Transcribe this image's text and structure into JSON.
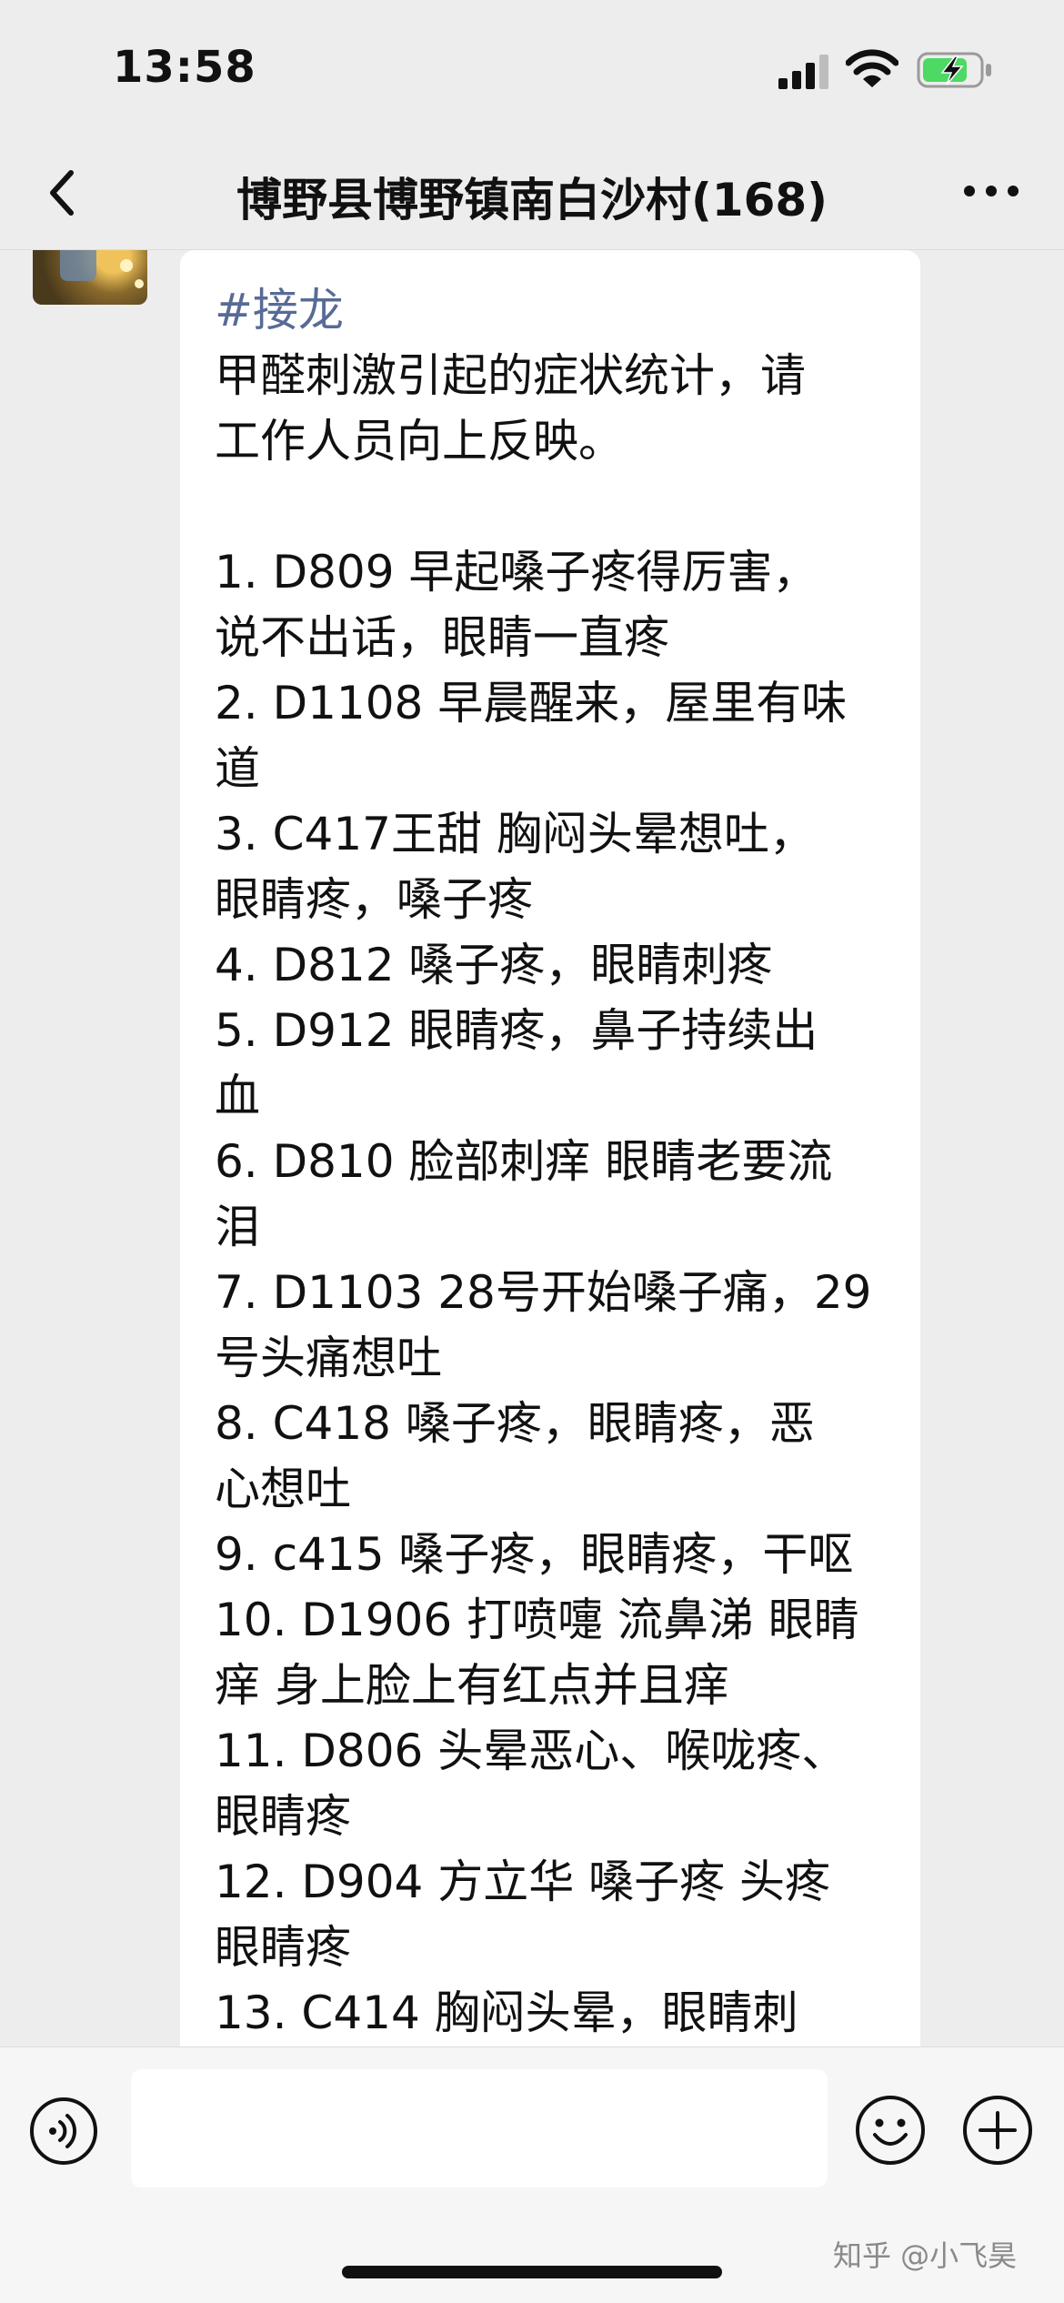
{
  "status_bar": {
    "time": "13:58"
  },
  "header": {
    "title": "博野县博野镇南白沙村(168)"
  },
  "message": {
    "hashtag": "#接龙",
    "lines": [
      "甲醛刺激引起的症状统计，请",
      "工作人员向上反映。",
      "",
      "1. D809 早起嗓子疼得厉害，",
      "说不出话，眼睛一直疼",
      "2. D1108 早晨醒来，屋里有味",
      "道",
      "3. C417王甜 胸闷头晕想吐，",
      "眼睛疼，嗓子疼",
      "4. D812 嗓子疼，眼睛刺疼",
      "5. D912 眼睛疼，鼻子持续出",
      "血",
      "6. D810 脸部刺痒 眼睛老要流",
      "泪",
      "7. D1103 28号开始嗓子痛，29",
      "号头痛想吐",
      "8. C418 嗓子疼，眼睛疼，恶",
      "心想吐",
      "9. c415 嗓子疼，眼睛疼，干呕",
      "10. D1906 打喷嚏 流鼻涕 眼睛",
      "痒 身上脸上有红点并且痒",
      "11. D806 头晕恶心、喉咙疼、",
      "眼睛疼",
      "12. D904 方立华 嗓子疼 头疼",
      "眼睛疼",
      "13. C414 胸闷头晕，眼睛刺"
    ]
  },
  "input": {
    "value": ""
  },
  "watermark": "知乎 @小飞昊",
  "colors": {
    "background": "#ededed",
    "bubble": "#ffffff",
    "hashtag": "#576b95",
    "battery_fill": "#4cd964"
  },
  "icons": {
    "back": "chevron-left-icon",
    "more": "more-dots-icon",
    "voice": "voice-icon",
    "emoji": "emoji-icon",
    "plus": "plus-icon",
    "signal": "cellular-signal-icon",
    "wifi": "wifi-icon",
    "battery": "battery-charging-icon"
  }
}
